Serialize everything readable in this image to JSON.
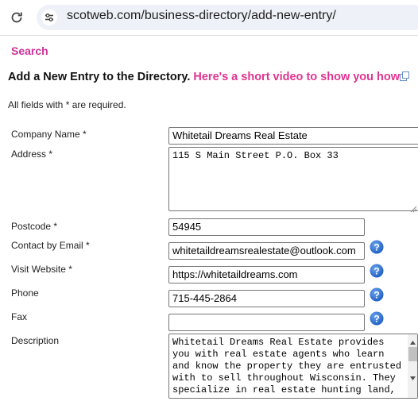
{
  "browser": {
    "url": "scotweb.com/business-directory/add-new-entry/"
  },
  "nav": {
    "search_label": "Search"
  },
  "heading": {
    "text": "Add a New Entry to the Directory.",
    "video_link": "Here's a short video to show you how"
  },
  "required_note": "All fields with * are required.",
  "form": {
    "company_name": {
      "label": "Company Name *",
      "value": "Whitetail Dreams Real Estate"
    },
    "address": {
      "label": "Address *",
      "value": "115 S Main Street P.O. Box 33"
    },
    "postcode": {
      "label": "Postcode *",
      "value": "54945"
    },
    "email": {
      "label": "Contact by Email *",
      "value": "whitetaildreamsrealestate@outlook.com"
    },
    "website": {
      "label": "Visit Website *",
      "value": "https://whitetaildreams.com"
    },
    "phone": {
      "label": "Phone",
      "value": "715-445-2864"
    },
    "fax": {
      "label": "Fax",
      "value": ""
    },
    "description": {
      "label": "Description",
      "value": "Whitetail Dreams Real Estate provides\nyou with real estate agents who learn\nand know the property they are entrusted\nwith to sell throughout Wisconsin. They\nspecialize in real estate hunting land,"
    }
  },
  "colors": {
    "accent": "#e0338f",
    "help_icon": "#2a6fd6"
  },
  "icons": [
    "reload-icon",
    "site-info-icon",
    "external-link-icon",
    "help-icon"
  ]
}
